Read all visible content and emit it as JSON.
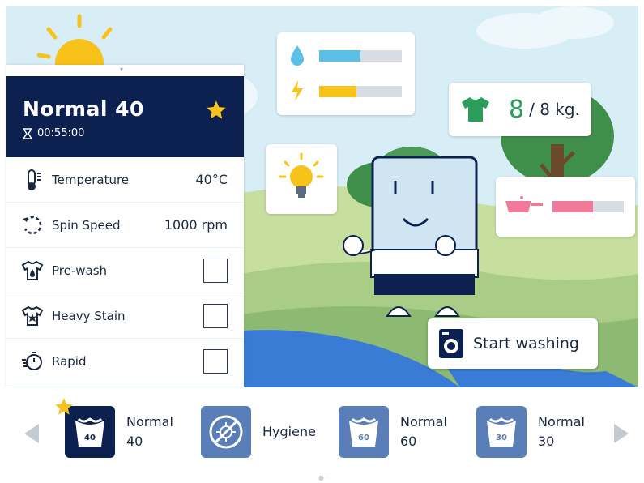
{
  "program": {
    "title": "Normal 40",
    "time": "00:55:00"
  },
  "options": [
    {
      "label": "Temperature",
      "value": "40°C",
      "icon": "thermometer-icon"
    },
    {
      "label": "Spin Speed",
      "value": "1000 rpm",
      "icon": "spin-icon"
    },
    {
      "label": "Pre-wash",
      "checked": false,
      "icon": "pre-wash-icon"
    },
    {
      "label": "Heavy Stain",
      "checked": false,
      "icon": "heavy-stain-icon"
    },
    {
      "label": "Rapid",
      "checked": false,
      "icon": "rapid-icon"
    }
  ],
  "status": {
    "water_level": 0.5,
    "energy_level": 0.45,
    "detergent_level": 0.57,
    "load_current": "8",
    "load_max": "/ 8 kg."
  },
  "start_button": {
    "label": "Start washing"
  },
  "carousel": {
    "items": [
      {
        "line1": "Normal",
        "line2": "40",
        "badge": "40",
        "selected": true,
        "favorite": true
      },
      {
        "line1": "Hygiene",
        "line2": "",
        "badge": "",
        "selected": false,
        "favorite": false
      },
      {
        "line1": "Normal",
        "line2": "60",
        "badge": "60",
        "selected": false,
        "favorite": false
      },
      {
        "line1": "Normal",
        "line2": "30",
        "badge": "30",
        "selected": false,
        "favorite": false
      }
    ]
  },
  "colors": {
    "header_bg": "#0d2150",
    "accent_yellow": "#f7c31a",
    "water_blue": "#5bbfe6",
    "load_green": "#2a9e5a",
    "detergent_pink": "#f07a9a",
    "icon_blue": "#5a7fb8"
  }
}
